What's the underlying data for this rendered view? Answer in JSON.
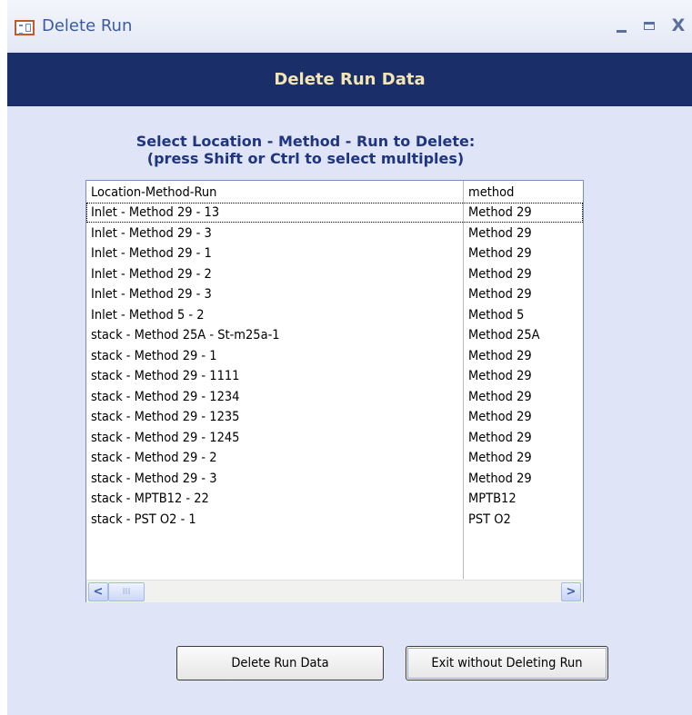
{
  "window": {
    "title": "Delete Run",
    "icon": "form-icon",
    "controls": {
      "minimize": "minimize-icon",
      "maximize": "maximize-icon",
      "close": "X"
    }
  },
  "header": {
    "title": "Delete Run Data"
  },
  "instructions": {
    "line1": "Select Location - Method - Run to Delete:",
    "line2": "(press Shift or Ctrl to select multiples)"
  },
  "listbox": {
    "columns": [
      "Location-Method-Run",
      "method"
    ],
    "rows": [
      [
        "Inlet - Method 29  - 13",
        "Method 29"
      ],
      [
        "Inlet - Method 29  - 3",
        "Method 29"
      ],
      [
        "Inlet - Method 29 - 1",
        "Method 29"
      ],
      [
        "Inlet - Method 29 - 2",
        "Method 29"
      ],
      [
        "Inlet - Method 29 - 3",
        "Method 29"
      ],
      [
        "Inlet - Method 5 - 2",
        "Method 5"
      ],
      [
        "stack - Method 25A - St-m25a-1",
        "Method 25A"
      ],
      [
        "stack - Method 29 - 1",
        "Method 29"
      ],
      [
        "stack - Method 29 - 1111",
        "Method 29"
      ],
      [
        "stack - Method 29 - 1234",
        "Method 29"
      ],
      [
        "stack - Method 29 - 1235",
        "Method 29"
      ],
      [
        "stack - Method 29 - 1245",
        "Method 29"
      ],
      [
        "stack - Method 29 - 2",
        "Method 29"
      ],
      [
        "stack - Method 29 - 3",
        "Method 29"
      ],
      [
        "stack - MPTB12 - 22",
        "MPTB12"
      ],
      [
        "stack - PST O2 - 1",
        "PST O2"
      ]
    ],
    "scrollbar": {
      "left_arrow": "<",
      "right_arrow": ">",
      "thumb_grip": "III"
    }
  },
  "buttons": {
    "delete": "Delete Run Data",
    "exit": "Exit without Deleting Run"
  },
  "colors": {
    "header_band": "#1a2f6a",
    "header_text": "#f3e6b4",
    "form_background": "#dfe4f7",
    "instruction_text": "#1f3580"
  }
}
